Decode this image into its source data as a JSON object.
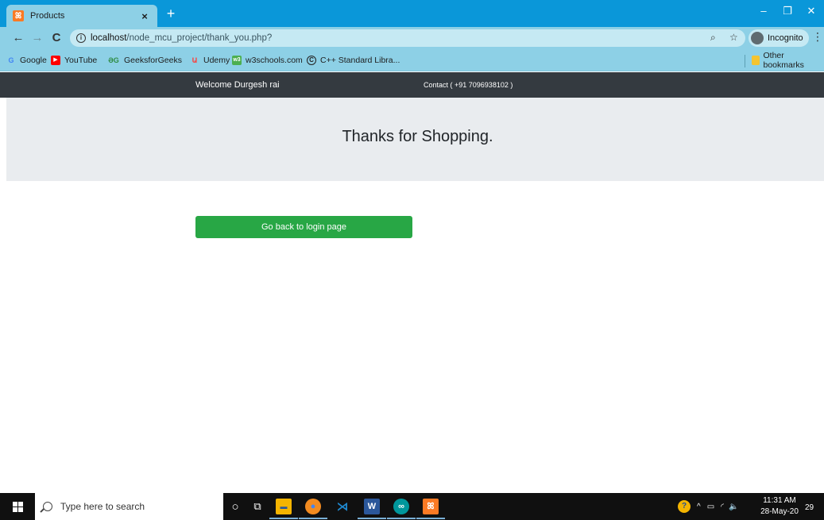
{
  "browser": {
    "tab": {
      "title": "Products",
      "close": "×",
      "new_tab": "+"
    },
    "window_controls": {
      "minimize": "–",
      "restore": "❐",
      "close": "✕"
    },
    "nav": {
      "back": "←",
      "forward": "→",
      "reload": "C"
    },
    "address": {
      "host": "localhost",
      "path": "/node_mcu_project/thank_you.php?"
    },
    "incognito_label": "Incognito",
    "bookmarks": [
      {
        "label": "Google",
        "icon": "G",
        "color": "#4285f4"
      },
      {
        "label": "YouTube",
        "icon": "▶",
        "color": "#ff0000"
      },
      {
        "label": "GeeksforGeeks",
        "icon": "ƏG",
        "color": "#2f8d46"
      },
      {
        "label": "Udemy",
        "icon": "Ա",
        "color": "#ec5252"
      },
      {
        "label": "w3schools.com",
        "icon": "w3",
        "color": "#4caf50"
      },
      {
        "label": "C++ Standard Libra...",
        "icon": "C",
        "color": "#222222"
      }
    ],
    "other_bookmarks": "Other bookmarks"
  },
  "page": {
    "nav": {
      "welcome": "Welcome Durgesh rai",
      "contact": "Contact ( +91 7096938102 )"
    },
    "heading": "Thanks for Shopping.",
    "back_button": "Go back to login page"
  },
  "taskbar": {
    "search_placeholder": "Type here to search",
    "clock_time": "11:31 AM",
    "clock_date": "28-May-20",
    "notification_count": "29",
    "apps": [
      {
        "name": "cortana-icon",
        "glyph": "○",
        "color": "transparent"
      },
      {
        "name": "task-view-icon",
        "glyph": "⧉",
        "color": "transparent"
      },
      {
        "name": "file-explorer-icon",
        "glyph": "▬",
        "color": "#f4b400"
      },
      {
        "name": "chrome-icon",
        "glyph": "●",
        "color": "#f28b20"
      },
      {
        "name": "vscode-icon",
        "glyph": "⋊",
        "color": "#1f8ad2"
      },
      {
        "name": "word-icon",
        "glyph": "W",
        "color": "#2b579a"
      },
      {
        "name": "arduino-icon",
        "glyph": "∞",
        "color": "#00979c"
      },
      {
        "name": "xampp-icon",
        "glyph": "ꕤ",
        "color": "#fb7a24"
      }
    ]
  },
  "colors": {
    "chrome_tabbar": "#0a97d9",
    "chrome_toolbar": "#8dd0e6",
    "navbar": "#343a40",
    "jumbotron": "#e9ecef",
    "button_success": "#28a745",
    "taskbar": "#101010"
  }
}
